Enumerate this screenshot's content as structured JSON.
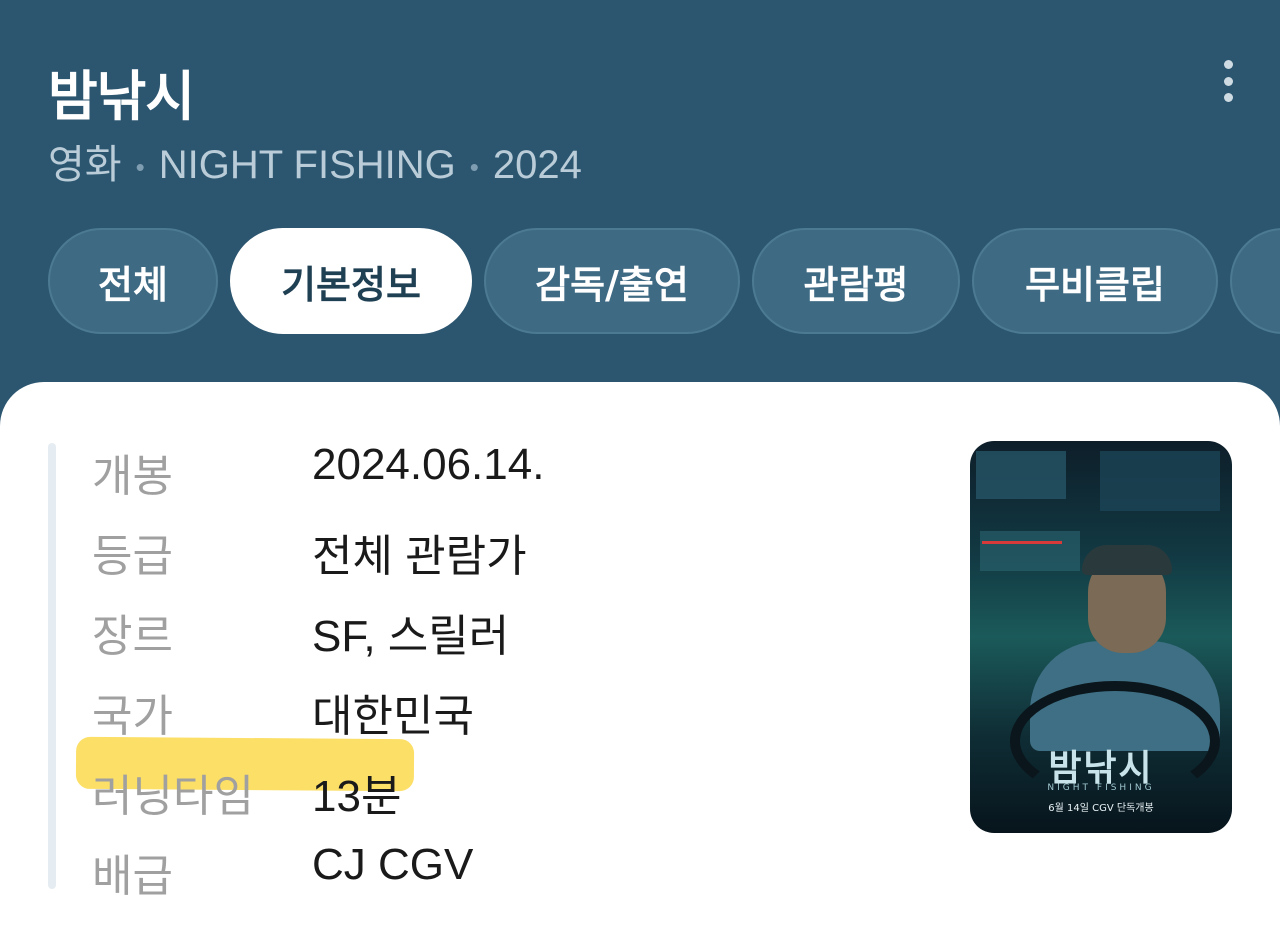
{
  "header": {
    "title": "밤낚시",
    "subtitle": {
      "category": "영화",
      "english_title": "NIGHT FISHING",
      "year": "2024"
    },
    "more_icon": "more-vertical-icon"
  },
  "tabs": [
    {
      "label": "전체",
      "active": false
    },
    {
      "label": "기본정보",
      "active": true
    },
    {
      "label": "감독/출연",
      "active": false
    },
    {
      "label": "관람평",
      "active": false
    },
    {
      "label": "무비클립",
      "active": false
    },
    {
      "label": "",
      "active": false
    }
  ],
  "info": {
    "rows": [
      {
        "label": "개봉",
        "value": "2024.06.14."
      },
      {
        "label": "등급",
        "value": "전체 관람가"
      },
      {
        "label": "장르",
        "value": "SF, 스릴러"
      },
      {
        "label": "국가",
        "value": "대한민국"
      },
      {
        "label": "러닝타임",
        "value": "13분"
      },
      {
        "label": "배급",
        "value": "CJ CGV"
      }
    ],
    "highlight_color": "#fbd94c"
  },
  "poster": {
    "title": "밤낚시",
    "subtitle": "NIGHT FISHING",
    "date_line": "6월 14일 CGV 단독개봉"
  },
  "colors": {
    "header_bg": "#2c5670",
    "tab_bg": "#3e6a84",
    "tab_active_bg": "#ffffff",
    "tab_active_text": "#1f3f53"
  }
}
